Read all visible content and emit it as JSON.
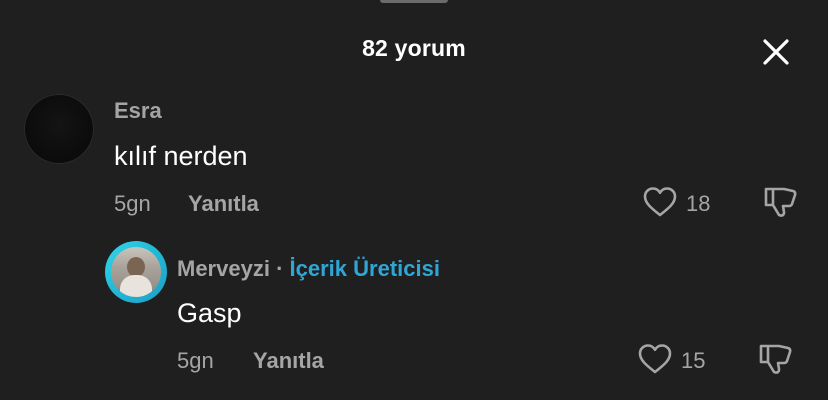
{
  "header": {
    "title": "82 yorum",
    "close_icon": "close-icon"
  },
  "comments": [
    {
      "username": "Esra",
      "text": "kılıf nerden",
      "time": "5gn",
      "reply_label": "Yanıtla",
      "likes": "18",
      "avatar": "dark-avatar"
    }
  ],
  "replies": [
    {
      "username": "Merveyzi",
      "separator": "·",
      "badge": "İçerik Üreticisi",
      "text": "Gasp",
      "time": "5gn",
      "reply_label": "Yanıtla",
      "likes": "15",
      "avatar": "photo-avatar"
    }
  ],
  "colors": {
    "background": "#1f1f1f",
    "primary_text": "#ffffff",
    "secondary_text": "#a5a5a5",
    "creator_badge": "#2fa6d6",
    "avatar_ring": "#20b8d6"
  }
}
